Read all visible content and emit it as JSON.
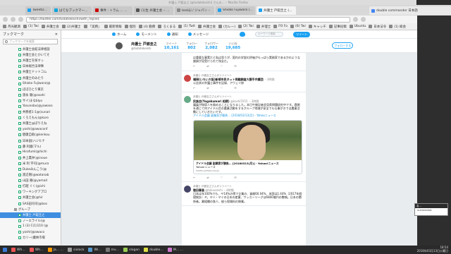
{
  "window": {
    "title": "弁護士 戸舘圭之 (@todatekeishi) さんの… ‒ Mozilla Firefox"
  },
  "tabs": [
    {
      "label": "TweetDeck",
      "color": "#1da1f2"
    },
    {
      "label": "はてなブックマーク ‒ hatena_b",
      "color": "#00a4de"
    },
    {
      "label": "事件 : トラム … 主法 ‒ 現場",
      "color": "#c00"
    },
    {
      "label": "(1)生 弁護士会 ‒ 政法の",
      "color": "#555"
    },
    {
      "label": "tenkiji / ジャパン ‒",
      "color": "#888"
    },
    {
      "label": "Shioko Fujiwara (@shioekohlade)",
      "color": "#1da1f2"
    },
    {
      "label": "弁護士 戸舘圭之 (@todatekeishi)",
      "color": "#1da1f2"
    }
  ],
  "doublecmd_tab": "double commander 日本語",
  "url": "https://twitter.com/todatekeishi/with_replies",
  "bookmarks": [
    "月光観測",
    "(1) Twi",
    "弁護士会",
    "(2)弁護士",
    "「実務」",
    "最新情報",
    "個別",
    "(4) 勤務",
    "ろくまる",
    "(1) Twit",
    "弁護士会",
    "(カレー)",
    "(2) Twi",
    "弁理士",
    "FO Fo",
    "(6) Twi",
    "キャッチ",
    "記事投稿",
    "Ubuntu",
    "日本法令",
    "(1) 総会"
  ],
  "sidebar": {
    "title": "ブックマーク",
    "search_placeholder": "ブックマークを検索",
    "items": [
      "弁護士会館法律相談",
      "弁護士会とかいてそ",
      "弁護士を探すっ",
      "日本総合法律事",
      "弁護士ドットコム",
      "弁護士のみたり",
      "Shioko Fujiwara(@",
      "ぼぼひとり東京",
      "渡永 駿(@asahi",
      "サイ(まなblyo",
      "Yasunobu(@yawaso",
      "共務者1-1@(sunari",
      "くろえもん(@kuro",
      "弁護士@ぼりえね",
      "yoshi(@awaconf",
      "健康自助(@kenkou",
      "日本国(ハジヒナ",
      "藤 利國(マル)",
      "Hirofumi(@hichi",
      "井上薫弁(@inoue",
      "米 利 宇司(@mura",
      "Dukeみんこう(@",
      "渡辺剛(@watanab",
      "山田 雅(@yamad",
      "打越 ぐく(@ichi",
      "ワーキングアプロ",
      "弁護士会(@hir",
      "SAS田司司(@bos"
    ],
    "folder": "グループ",
    "selected": "弁護士 戸舘圭之",
    "after": [
      "ノーエライル(@",
      "1 (3) C(1)110 (@",
      "yoshi(@awaco",
      "カリー(農林市場"
    ]
  },
  "twitter": {
    "nav": [
      "ホーム",
      "モーメント",
      "通知",
      "メッセージ"
    ],
    "search_placeholder": "キーワード検索",
    "tweet_button": "ツイート",
    "profile_name": "弁護士 戸舘圭之",
    "profile_handle": "@todatekeishi",
    "stats": [
      {
        "label": "ツイート",
        "value": "10,161"
      },
      {
        "label": "フォロー",
        "value": "802"
      },
      {
        "label": "フォロワー",
        "value": "2,082"
      },
      {
        "label": "いいね",
        "value": "19,685"
      }
    ],
    "follow_button": "フォローする",
    "tweets": [
      {
        "retweet": "",
        "name": "",
        "handle": "",
        "text": "は重要な事実だと私は思うが、国内の学説の評価がもっぱら実務家であるかのような論調が見受けられて残念だ。",
        "counts": [
          "",
          "",
          ""
        ]
      },
      {
        "retweet": "弁護士 戸舘圭之さんがリツイート",
        "name": "福岡(いちい大阪)新規市民ネット問題調査大勝手弁護団",
        "handle": "・3時間",
        "text": "公告状の弁護士事件を記録、アウェイ修",
        "counts": [
          "",
          "",
          ""
        ]
      },
      {
        "retweet": "弁護士 戸舘圭之さんがリツイート",
        "name": "民族会(Yogakumari 相模)",
        "handle": "@kashi5555 ・3時間",
        "text": "議員が指導人を務めることになりました。本日午後記者会見県問題研究中です。鹿側を通じて何アイドル目の農業活動をするグループ地域が安全でも仕事がきでは農業活動にしていきたいです。",
        "link": "アイドル会議 副業家が勝負… [2018/03/13(月) - Yahooニュース",
        "counts": [
          "",
          "",
          ""
        ]
      },
      {
        "retweet": "弁護士 戸舘圭之さんがリツイート",
        "name": "徹田春喜",
        "handle": "@tokuoeishi ・4時間",
        "text": "日本は年100%でも、ヤ14%の傍で企業の、貢献60.04%、米国は1.44%（2017年経理統計）ヤ。ヤハ・ヤイの日本の産業、サッカーリーグは6800億円の整頓。日本の関係者。業組織の各人、彼ら保険料の移業。",
        "counts": [
          "",
          "",
          ""
        ]
      }
    ],
    "card": {
      "title": "アイドル会議 副業家が勝負… [20180313(月)] - Yahoo!ニュース",
      "sub": "Yahoo!ニュース",
      "domain": "news.yahoo.co.jp"
    }
  },
  "mini_window": {
    "title": "名...",
    "body": "scrreenshot"
  },
  "taskbar": {
    "items": [
      "Wh…",
      "Wh…",
      "Ja… …",
      "sixlock",
      "Wi…",
      "mv…",
      "slogan",
      "double…",
      "M… …"
    ],
    "time": "18:54",
    "date": "2018年03月13日火曜日"
  }
}
